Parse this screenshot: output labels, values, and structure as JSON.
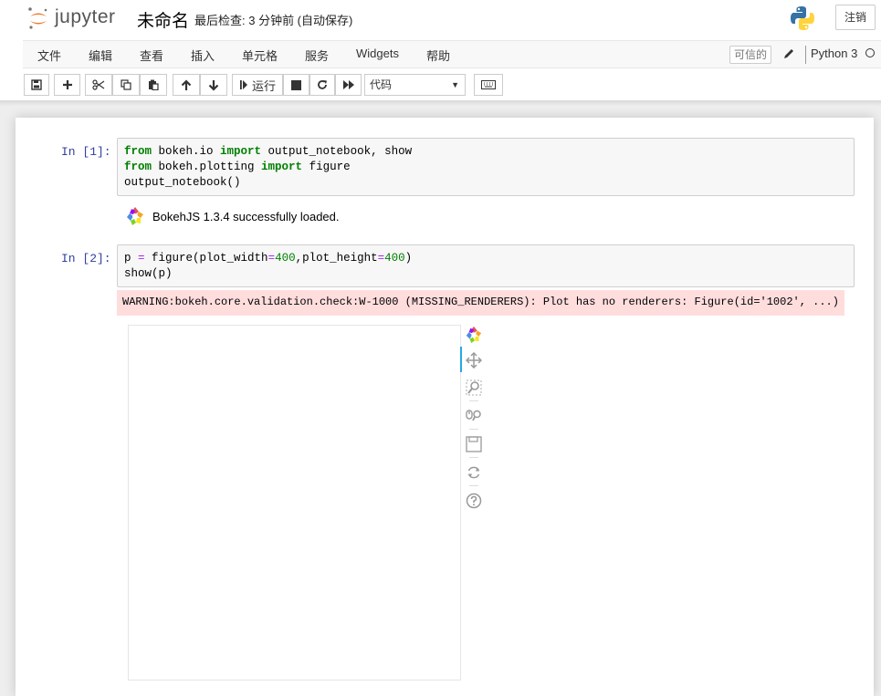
{
  "header": {
    "logo_text": "jupyter",
    "notebook_name": "未命名",
    "checkpoint": "最后检查: 3 分钟前  (自动保存)",
    "logout_label": "注销"
  },
  "menubar": {
    "items": [
      "文件",
      "编辑",
      "查看",
      "插入",
      "单元格",
      "服务",
      "Widgets",
      "帮助"
    ],
    "trusted_label": "可信的",
    "kernel_name": "Python 3"
  },
  "toolbar": {
    "run_label": "运行",
    "cell_type": "代码",
    "icons": [
      "save-icon",
      "plus-icon",
      "scissors-icon",
      "copy-icon",
      "paste-icon",
      "arrow-up-icon",
      "arrow-down-icon",
      "step-forward-icon",
      "stop-icon",
      "restart-icon",
      "fast-forward-icon",
      "keyboard-icon"
    ]
  },
  "cells": [
    {
      "prompt": "In  [1]:",
      "code": [
        {
          "parts": [
            [
              "kw",
              "from"
            ],
            [
              "t",
              " bokeh.io "
            ],
            [
              "kw",
              "import"
            ],
            [
              "t",
              " output_notebook, show"
            ]
          ]
        },
        {
          "parts": [
            [
              "kw",
              "from"
            ],
            [
              "t",
              " bokeh.plotting "
            ],
            [
              "kw",
              "import"
            ],
            [
              "t",
              " figure"
            ]
          ]
        },
        {
          "parts": [
            [
              "t",
              "output_notebook()"
            ]
          ]
        }
      ],
      "output_text": "BokehJS 1.3.4 successfully loaded."
    },
    {
      "prompt": "In  [2]:",
      "code": [
        {
          "parts": [
            [
              "t",
              "p "
            ],
            [
              "op",
              "="
            ],
            [
              "t",
              " figure(plot_width"
            ],
            [
              "op",
              "="
            ],
            [
              "num",
              "400"
            ],
            [
              "t",
              ",plot_height"
            ],
            [
              "op",
              "="
            ],
            [
              "num",
              "400"
            ],
            [
              "t",
              ")"
            ]
          ]
        },
        {
          "parts": [
            [
              "t",
              "show(p)"
            ]
          ]
        }
      ],
      "warning": "WARNING:bokeh.core.validation.check:W-1000 (MISSING_RENDERERS): Plot has no renderers: Figure(id='1002', ...)"
    }
  ],
  "plot_tools": [
    "bokeh-logo-icon",
    "pan-icon",
    "box-zoom-icon",
    "wheel-zoom-icon",
    "save-icon",
    "reset-icon",
    "help-icon"
  ],
  "colors": {
    "prompt": "#303f9f",
    "keyword": "#008000",
    "warning_bg": "#ffdddd",
    "active_tool": "#26aae1"
  }
}
